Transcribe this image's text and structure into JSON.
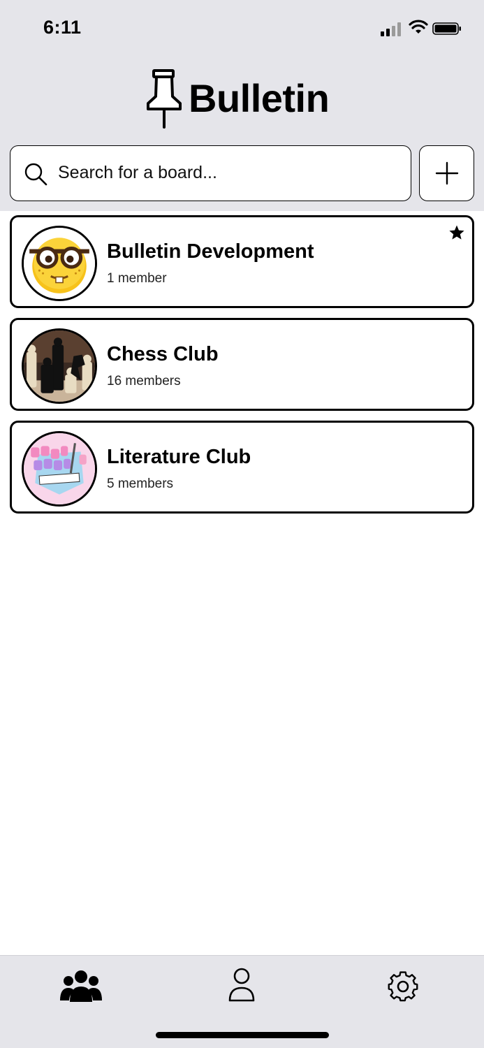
{
  "status_bar": {
    "time": "6:11",
    "icons": [
      "cellular-signal-icon",
      "wifi-icon",
      "battery-icon"
    ]
  },
  "app": {
    "title": "Bulletin",
    "logo_icon": "pushpin-icon"
  },
  "search": {
    "placeholder": "Search for a board...",
    "value": "",
    "icon": "search-icon"
  },
  "add_button": {
    "icon": "plus-icon"
  },
  "boards": [
    {
      "name": "Bulletin Development",
      "members": "1 member",
      "starred": true,
      "avatar": "nerd-face-emoji-image"
    },
    {
      "name": "Chess Club",
      "members": "16 members",
      "starred": false,
      "avatar": "chess-pieces-photo"
    },
    {
      "name": "Literature Club",
      "members": "5 members",
      "starred": false,
      "avatar": "doki-doki-literature-club-logo"
    }
  ],
  "tabbar": {
    "tabs": [
      {
        "icon": "group-icon",
        "active": true
      },
      {
        "icon": "person-icon",
        "active": false
      },
      {
        "icon": "settings-gear-icon",
        "active": false
      }
    ]
  },
  "colors": {
    "header_background": "#e5e5ea",
    "tabbar_background": "#e5e5ea",
    "card_border": "#000000",
    "text": "#000000",
    "page_background": "#ffffff"
  }
}
